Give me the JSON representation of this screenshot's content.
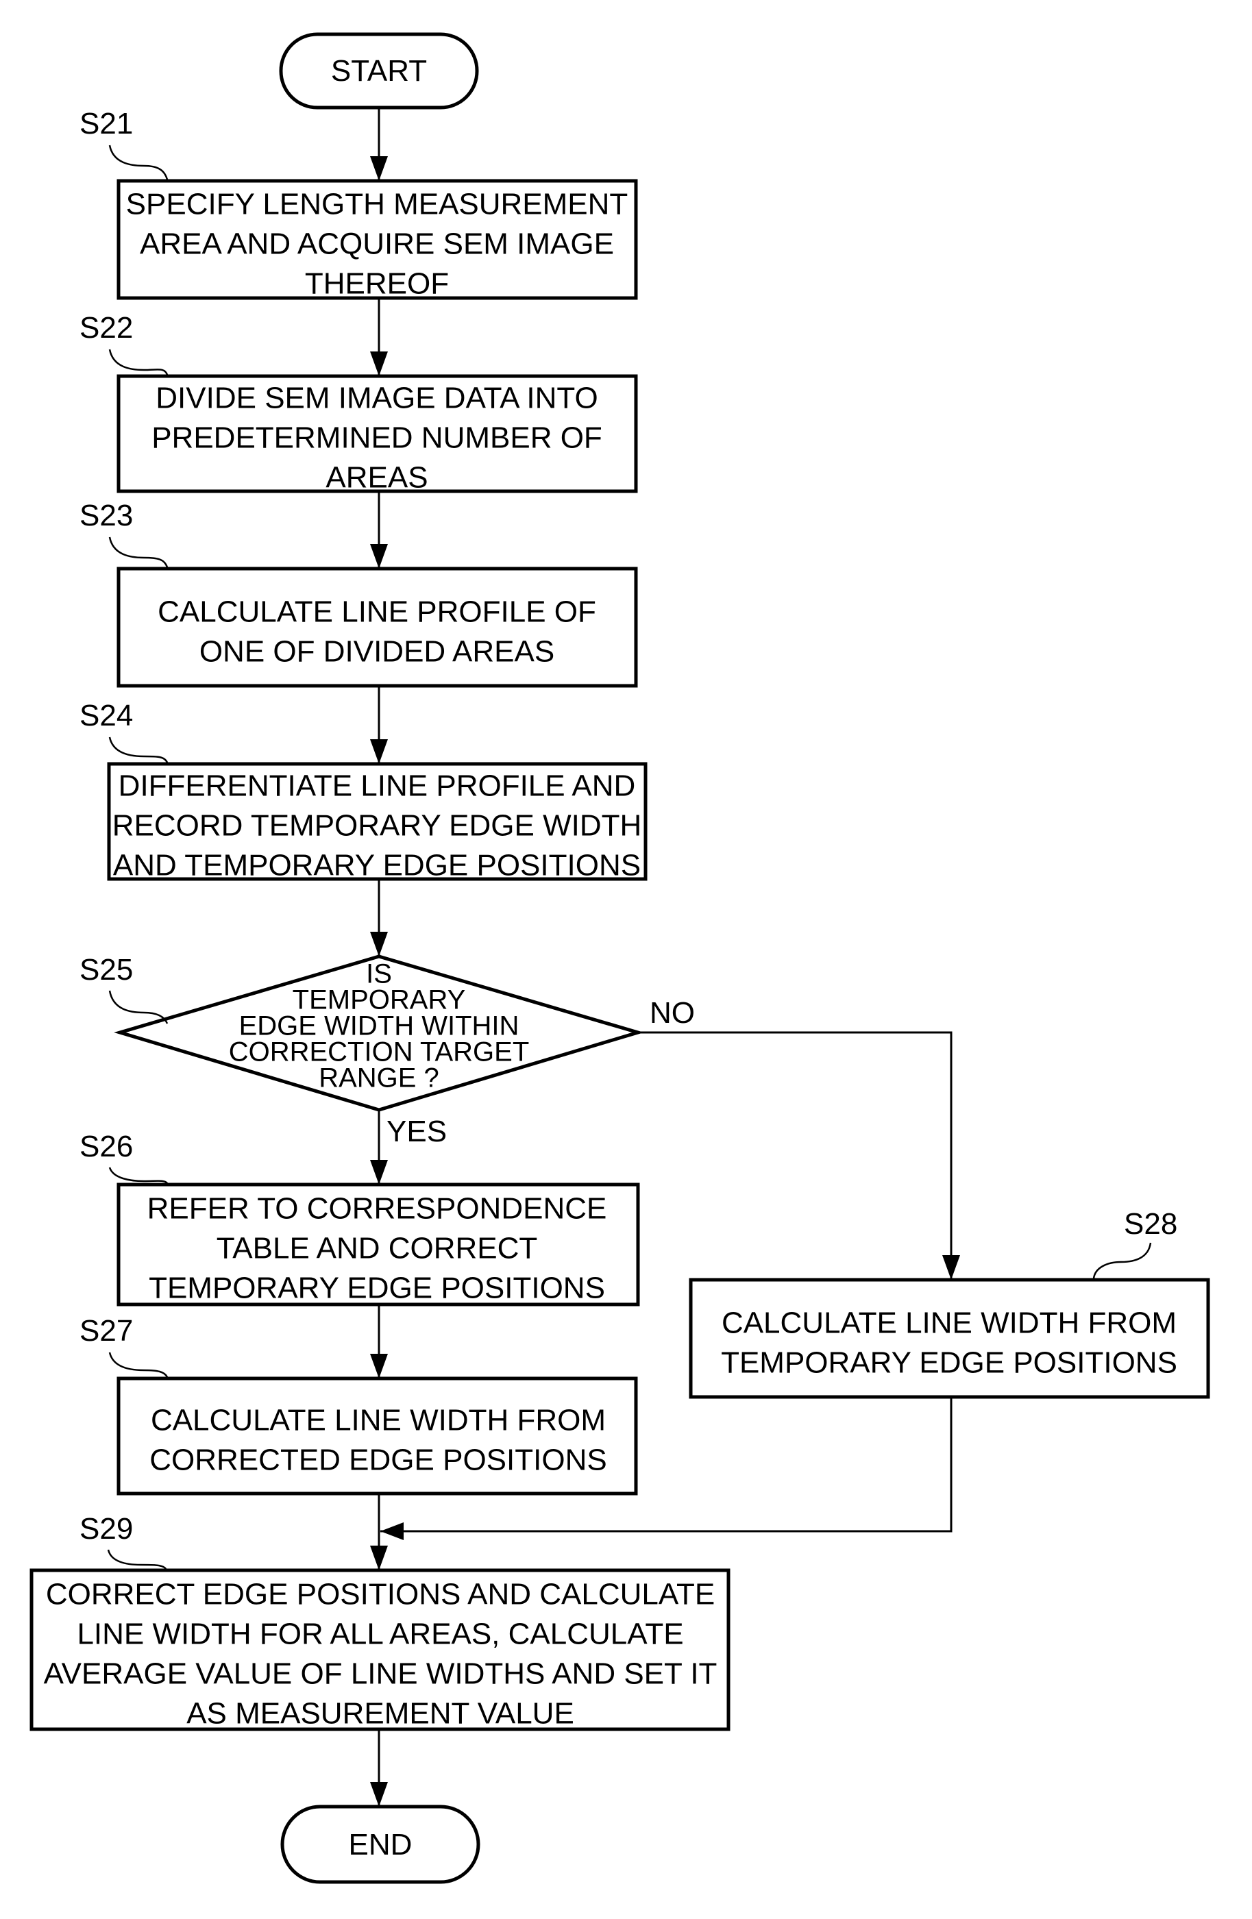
{
  "diagram": {
    "type": "flowchart",
    "start": {
      "label": "START"
    },
    "end": {
      "label": "END"
    },
    "steps": {
      "S21": {
        "id": "S21",
        "lines": [
          "SPECIFY LENGTH MEASUREMENT",
          "AREA AND ACQUIRE SEM IMAGE",
          "THEREOF"
        ]
      },
      "S22": {
        "id": "S22",
        "lines": [
          "DIVIDE SEM IMAGE DATA INTO",
          "PREDETERMINED NUMBER OF",
          "AREAS"
        ]
      },
      "S23": {
        "id": "S23",
        "lines": [
          "CALCULATE LINE PROFILE OF",
          "ONE OF DIVIDED AREAS"
        ]
      },
      "S24": {
        "id": "S24",
        "lines": [
          "DIFFERENTIATE LINE PROFILE AND",
          "RECORD TEMPORARY EDGE WIDTH",
          "AND TEMPORARY EDGE POSITIONS"
        ]
      },
      "S25": {
        "id": "S25",
        "lines": [
          "IS",
          "TEMPORARY",
          "EDGE WIDTH WITHIN",
          "CORRECTION TARGET",
          "RANGE ?"
        ]
      },
      "S26": {
        "id": "S26",
        "lines": [
          "REFER TO CORRESPONDENCE",
          "TABLE AND CORRECT",
          "TEMPORARY EDGE POSITIONS"
        ]
      },
      "S27": {
        "id": "S27",
        "lines": [
          "CALCULATE LINE WIDTH FROM",
          "CORRECTED EDGE POSITIONS"
        ]
      },
      "S28": {
        "id": "S28",
        "lines": [
          "CALCULATE LINE WIDTH FROM",
          "TEMPORARY EDGE POSITIONS"
        ]
      },
      "S29": {
        "id": "S29",
        "lines": [
          "CORRECT EDGE POSITIONS AND CALCULATE",
          "LINE WIDTH FOR ALL AREAS, CALCULATE",
          "AVERAGE VALUE OF LINE WIDTHS AND SET IT",
          "AS MEASUREMENT VALUE"
        ]
      }
    },
    "branches": {
      "yes": "YES",
      "no": "NO"
    },
    "edges": [
      {
        "from": "START",
        "to": "S21"
      },
      {
        "from": "S21",
        "to": "S22"
      },
      {
        "from": "S22",
        "to": "S23"
      },
      {
        "from": "S23",
        "to": "S24"
      },
      {
        "from": "S24",
        "to": "S25"
      },
      {
        "from": "S25",
        "to": "S26",
        "label": "YES"
      },
      {
        "from": "S25",
        "to": "S28",
        "label": "NO"
      },
      {
        "from": "S26",
        "to": "S27"
      },
      {
        "from": "S27",
        "to": "S29"
      },
      {
        "from": "S28",
        "to": "S29"
      },
      {
        "from": "S29",
        "to": "END"
      }
    ]
  }
}
